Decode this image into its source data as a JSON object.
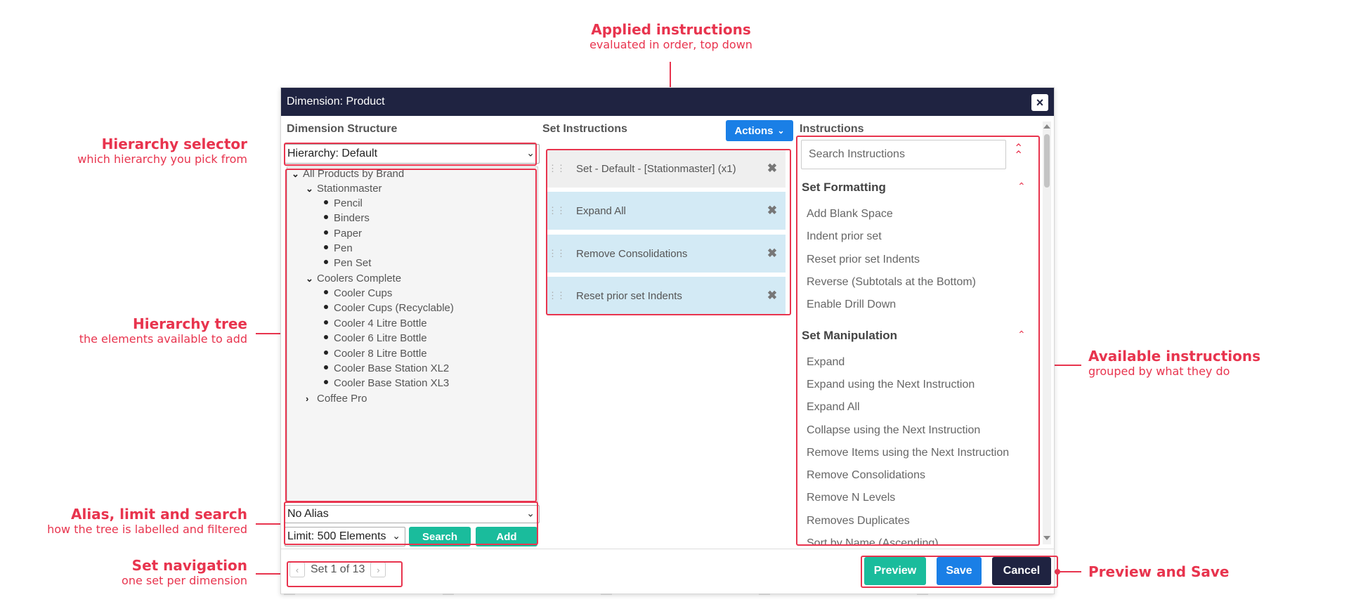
{
  "callouts": {
    "applied": {
      "title": "Applied instructions",
      "sub": "evaluated in order, top down"
    },
    "hierarchy_selector": {
      "title": "Hierarchy selector",
      "sub": "which hierarchy you pick from"
    },
    "hierarchy_tree": {
      "title": "Hierarchy tree",
      "sub": "the elements available to add"
    },
    "alias_limit": {
      "title": "Alias, limit and search",
      "sub": "how the tree is labelled and filtered"
    },
    "set_nav": {
      "title": "Set navigation",
      "sub": "one set per dimension"
    },
    "available": {
      "title": "Available instructions",
      "sub": "grouped by what they do"
    },
    "preview_save": {
      "title": "Preview and Save"
    }
  },
  "dialog": {
    "title": "Dimension: Product",
    "close_icon": "×"
  },
  "dimension_structure": {
    "title": "Dimension Structure",
    "hierarchy_select": "Hierarchy: Default",
    "tree": {
      "root": "All Products by Brand",
      "brands": [
        {
          "name": "Stationmaster",
          "expanded": true,
          "items": [
            "Pencil",
            "Binders",
            "Paper",
            "Pen",
            "Pen Set"
          ]
        },
        {
          "name": "Coolers Complete",
          "expanded": true,
          "items": [
            "Cooler Cups",
            "Cooler Cups (Recyclable)",
            "Cooler 4 Litre Bottle",
            "Cooler 6 Litre Bottle",
            "Cooler 8 Litre Bottle",
            "Cooler Base Station XL2",
            "Cooler Base Station XL3"
          ]
        },
        {
          "name": "Coffee Pro",
          "expanded": false,
          "items": []
        }
      ]
    },
    "alias_select": "No Alias",
    "limit_select": "Limit: 500 Elements",
    "search_button": "Search",
    "add_button": "Add"
  },
  "set_instructions": {
    "title": "Set Instructions",
    "actions_button": "Actions",
    "items": [
      "Set - Default - [Stationmaster] (x1)",
      "Expand All",
      "Remove Consolidations",
      "Reset prior set Indents"
    ]
  },
  "instructions": {
    "title": "Instructions",
    "search_placeholder": "Search Instructions",
    "groups": [
      {
        "title": "Set Formatting",
        "items": [
          "Add Blank Space",
          "Indent prior set",
          "Reset prior set Indents",
          "Reverse (Subtotals at the Bottom)",
          "Enable Drill Down"
        ]
      },
      {
        "title": "Set Manipulation",
        "items": [
          "Expand",
          "Expand using the Next Instruction",
          "Expand All",
          "Collapse using the Next Instruction",
          "Remove Items using the Next Instruction",
          "Remove Consolidations",
          "Remove N Levels",
          "Removes Duplicates",
          "Sort by Name (Ascending)"
        ]
      }
    ]
  },
  "footer": {
    "pager_label": "Set 1 of 13",
    "preview_button": "Preview",
    "save_button": "Save",
    "cancel_button": "Cancel"
  },
  "colors": {
    "accent": "#e8344e",
    "header": "#1f2341",
    "green": "#1abc9c",
    "blue": "#1a7fe6",
    "card": "#d3eaf5"
  }
}
